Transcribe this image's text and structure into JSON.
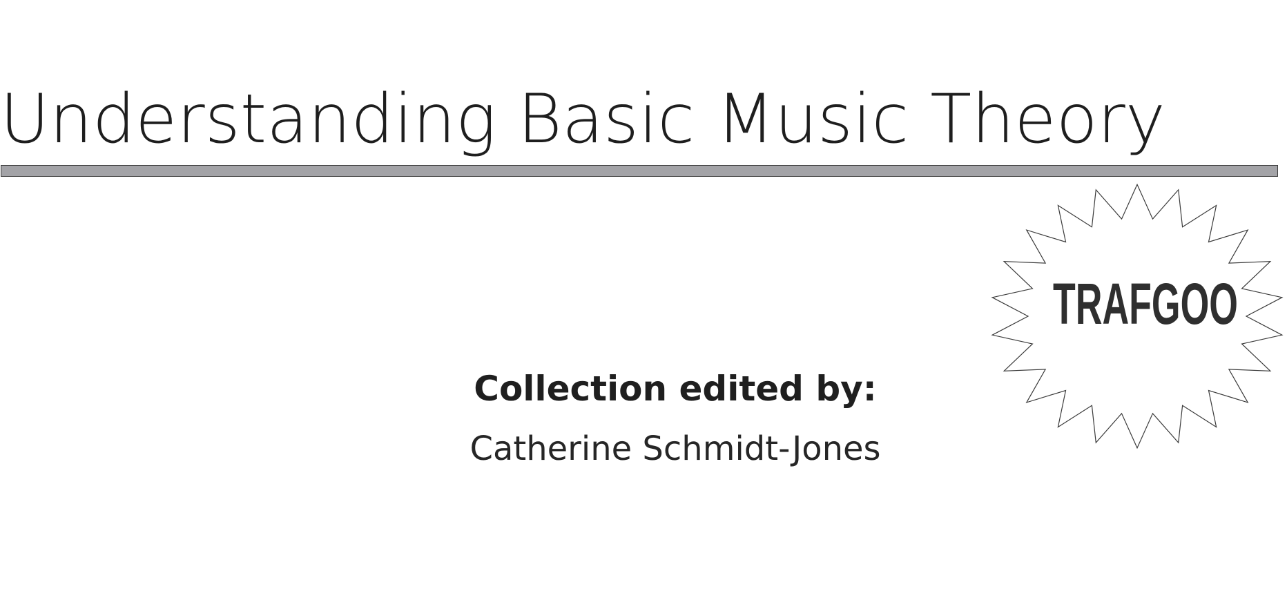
{
  "document": {
    "title": "Understanding Basic Music Theory",
    "collection_label": "Collection edited by:",
    "editor": "Catherine Schmidt-Jones"
  },
  "stamp": {
    "text": "TRAFGOO"
  },
  "colors": {
    "rule_fill": "#a3a3a7",
    "rule_border": "#3a3a3a",
    "text": "#1e1e1e"
  }
}
